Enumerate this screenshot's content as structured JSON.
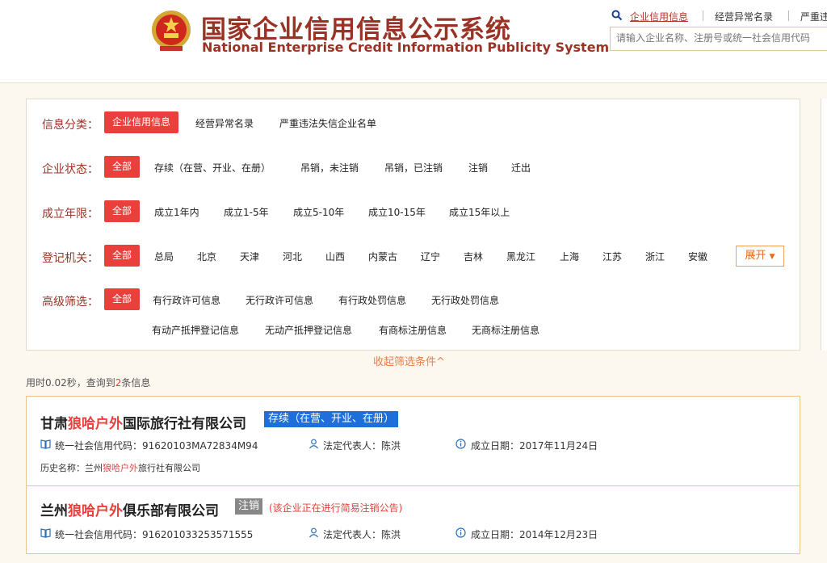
{
  "header": {
    "title_cn": "国家企业信用信息公示系统",
    "title_en": "National Enterprise Credit Information Publicity System",
    "tabs": [
      "企业信用信息",
      "经营异常名录",
      "严重违"
    ],
    "search_placeholder": "请输入企业名称、注册号或统一社会信用代码",
    "colors": {
      "brand": "#9a3326",
      "accent": "#e9403b"
    }
  },
  "filters": {
    "info_category": {
      "label": "信息分类：",
      "options": [
        "企业信用信息",
        "经营异常名录",
        "严重违法失信企业名单"
      ],
      "selected": "企业信用信息"
    },
    "status": {
      "label": "企业状态：",
      "all": "全部",
      "options": [
        "存续（在营、开业、在册）",
        "吊销，未注销",
        "吊销，已注销",
        "注销",
        "迁出"
      ]
    },
    "years": {
      "label": "成立年限：",
      "all": "全部",
      "options": [
        "成立1年内",
        "成立1-5年",
        "成立5-10年",
        "成立10-15年",
        "成立15年以上"
      ]
    },
    "authority": {
      "label": "登记机关：",
      "all": "全部",
      "options": [
        "总局",
        "北京",
        "天津",
        "河北",
        "山西",
        "内蒙古",
        "辽宁",
        "吉林",
        "黑龙江",
        "上海",
        "江苏",
        "浙江",
        "安徽"
      ],
      "expand": "展开"
    },
    "advanced": {
      "label": "高级筛选：",
      "all": "全部",
      "options": [
        "有行政许可信息",
        "无行政许可信息",
        "有行政处罚信息",
        "无行政处罚信息",
        "有动产抵押登记信息",
        "无动产抵押登记信息",
        "有商标注册信息",
        "无商标注册信息"
      ]
    },
    "collapse": "收起筛选条件^"
  },
  "stats": {
    "prefix": "用时0.02秒，查询到",
    "count": "2",
    "suffix": "条信息"
  },
  "results": [
    {
      "name_pre": "甘肃",
      "name_hl": "狼哈户外",
      "name_post": "国际旅行社有限公司",
      "badge": "存续（在营、开业、在册）",
      "credit_label": "统一社会信用代码：",
      "credit": "91620103MA72834M94",
      "rep_label": "法定代表人：",
      "rep": "陈洪",
      "date_label": "成立日期：",
      "date": "2017年11月24日",
      "hist_label": "历史名称：",
      "hist_pre": "兰州",
      "hist_hl": "狼哈户外",
      "hist_post": "旅行社有限公司"
    },
    {
      "name_pre": "兰州",
      "name_hl": "狼哈户外",
      "name_post": "俱乐部有限公司",
      "badge": "注销",
      "notice": "(该企业正在进行简易注销公告)",
      "credit_label": "统一社会信用代码：",
      "credit": "916201033253571555",
      "rep_label": "法定代表人：",
      "rep": "陈洪",
      "date_label": "成立日期：",
      "date": "2014年12月23日"
    }
  ]
}
